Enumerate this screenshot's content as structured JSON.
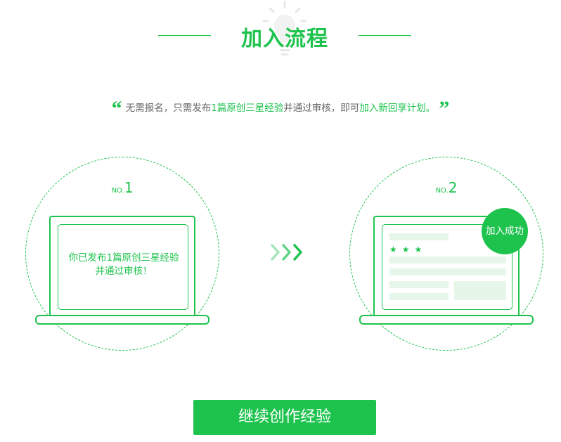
{
  "header": {
    "title": "加入流程",
    "icon": "lightbulb-icon",
    "accent_color": "#1ec34e"
  },
  "quote": {
    "open_mark": "“",
    "close_mark": "”",
    "text_1": "无需报名，只需发布",
    "highlight_1": "1篇原创三星经验",
    "text_2": "并通过审核，即可",
    "highlight_2": "加入新回享计划",
    "text_3": "。"
  },
  "steps": [
    {
      "no_prefix": "NO.",
      "no_number": "1",
      "message_line1": "你已发布1篇原创三星经验",
      "message_line2": "并通过审核！",
      "icon": "laptop-icon"
    },
    {
      "no_prefix": "NO.",
      "no_number": "2",
      "badge": "加入成功",
      "icon": "laptop-icon",
      "stars": "★★★"
    }
  ],
  "arrows_icon": "triple-chevron-right-icon",
  "cta_label": "继续创作经验"
}
